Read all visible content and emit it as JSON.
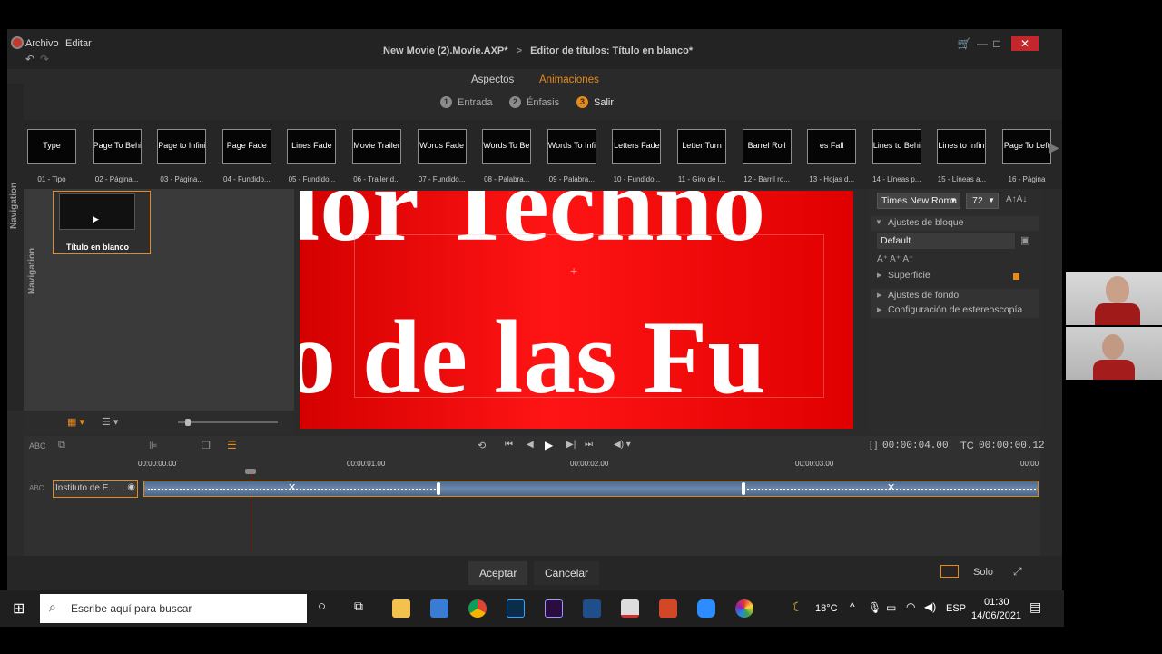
{
  "titlebar": {
    "menu": [
      "Archivo",
      "Editar"
    ],
    "breadcrumb_project": "New Movie (2).Movie.AXP*",
    "breadcrumb_sep": ">",
    "breadcrumb_page": "Editor de títulos: Título en blanco*"
  },
  "tabs": {
    "aspects": "Aspectos",
    "animations": "Animaciones"
  },
  "steps": [
    {
      "num": "1",
      "label": "Entrada"
    },
    {
      "num": "2",
      "label": "Énfasis"
    },
    {
      "num": "3",
      "label": "Salir"
    }
  ],
  "animations": [
    {
      "thumb": "Type",
      "caption": "01 - Tipo"
    },
    {
      "thumb": "Page To Behind",
      "caption": "02 - Página..."
    },
    {
      "thumb": "Page to Infinity",
      "caption": "03 - Página..."
    },
    {
      "thumb": "Page Fade",
      "caption": "04 - Fundido..."
    },
    {
      "thumb": "Lines Fade",
      "caption": "05 - Fundido..."
    },
    {
      "thumb": "Movie Trailer",
      "caption": "06 - Trailer d..."
    },
    {
      "thumb": "Words Fade",
      "caption": "07 - Fundido..."
    },
    {
      "thumb": "Words To Behind",
      "caption": "08 - Palabra..."
    },
    {
      "thumb": "Words To Infinity",
      "caption": "09 - Palabra..."
    },
    {
      "thumb": "Letters Fade",
      "caption": "10 - Fundido..."
    },
    {
      "thumb": "Letter Turn",
      "caption": "11 - Giro de l..."
    },
    {
      "thumb": "Barrel Roll",
      "caption": "12 - Barril ro..."
    },
    {
      "thumb": "es Fall",
      "caption": "13 - Hojas d..."
    },
    {
      "thumb": "Lines to Behind",
      "caption": "14 - Líneas p..."
    },
    {
      "thumb": "Lines to Infinity",
      "caption": "15 - Líneas a..."
    },
    {
      "thumb": "Page To Left",
      "caption": "16 - Página"
    }
  ],
  "left_panel": {
    "nav_label": "Navigation",
    "item_label": "Título en blanco"
  },
  "preview": {
    "line1": "lor Techno",
    "line2": "o de las Fu"
  },
  "right_panel": {
    "font": "Times New Roma",
    "size": "72",
    "block_settings": "Ajustes de bloque",
    "style": "Default",
    "surface": "Superficie",
    "bg_settings": "Ajustes de fondo",
    "stereo_settings": "Configuración de estereoscopía"
  },
  "timeline": {
    "duration": "00:00:04.00",
    "tc_label": "TC",
    "tc_value": "00:00:00.12",
    "ruler": [
      "00:00:00.00",
      "00:00:01.00",
      "00:00:02.00",
      "00:00:03.00",
      "00:00"
    ],
    "track_label": "Instituto de E..."
  },
  "bottom": {
    "accept": "Aceptar",
    "cancel": "Cancelar",
    "solo": "Solo"
  },
  "taskbar": {
    "search_placeholder": "Escribe aquí para buscar",
    "weather": "18°C",
    "lang": "ESP",
    "time": "01:30",
    "date": "14/06/2021"
  },
  "colors": {
    "accent_orange": "#e88a1a",
    "preview_red": "#ff1414",
    "track_blue": "#6b87aa"
  }
}
